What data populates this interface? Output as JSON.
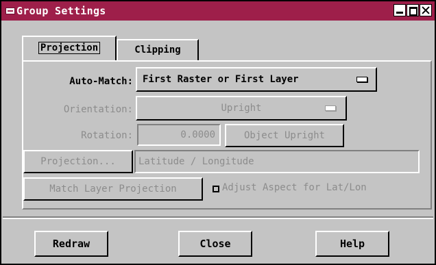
{
  "window": {
    "title": "Group Settings"
  },
  "tabs": [
    {
      "label": "Projection",
      "active": true
    },
    {
      "label": "Clipping",
      "active": false
    }
  ],
  "auto_match": {
    "label": "Auto-Match:",
    "value": "First Raster or First Layer"
  },
  "orientation": {
    "label": "Orientation:",
    "value": "Upright",
    "enabled": false
  },
  "rotation": {
    "label": "Rotation:",
    "value": "0.0000",
    "button": "Object Upright",
    "enabled": false
  },
  "projection": {
    "button": "Projection...",
    "value": "Latitude / Longitude",
    "enabled": false
  },
  "match_layer": {
    "button": "Match Layer Projection",
    "checkbox_label": "Adjust Aspect for Lat/Lon",
    "checked": false,
    "enabled": false
  },
  "footer": {
    "redraw": "Redraw",
    "close": "Close",
    "help": "Help"
  },
  "colors": {
    "titlebar": "#9e1f4a",
    "face": "#c4c4c4",
    "disabled_text": "#8c8c8c"
  },
  "icons": {
    "window_menu": "window-menu-icon",
    "minimize": "minimize-icon",
    "maximize": "maximize-icon",
    "close": "close-icon",
    "dropdown": "option-menu-indicator-icon"
  }
}
